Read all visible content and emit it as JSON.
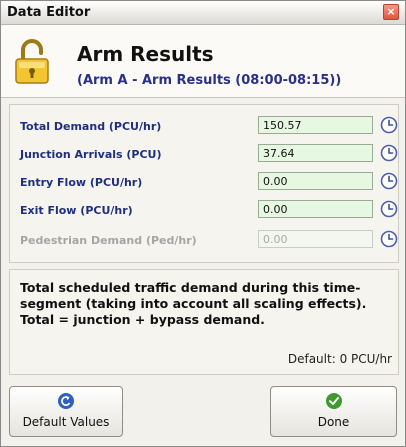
{
  "window": {
    "title": "Data Editor"
  },
  "header": {
    "title": "Arm Results",
    "subtitle": "(Arm A - Arm Results (08:00-08:15))",
    "icon": "lock-icon"
  },
  "fields": [
    {
      "label": "Total Demand (PCU/hr)",
      "value": "150.57",
      "enabled": true,
      "icon": "clock-icon"
    },
    {
      "label": "Junction Arrivals (PCU)",
      "value": "37.64",
      "enabled": true,
      "icon": "clock-icon"
    },
    {
      "label": "Entry Flow (PCU/hr)",
      "value": "0.00",
      "enabled": true,
      "icon": "clock-icon"
    },
    {
      "label": "Exit Flow (PCU/hr)",
      "value": "0.00",
      "enabled": true,
      "icon": "clock-icon"
    },
    {
      "label": "Pedestrian Demand (Ped/hr)",
      "value": "0.00",
      "enabled": false,
      "icon": "clock-icon"
    }
  ],
  "description": {
    "text": "Total scheduled traffic demand during this time-segment (taking into account all scaling effects).  Total = junction + bypass demand.",
    "default": "Default: 0 PCU/hr"
  },
  "buttons": {
    "default_values": "Default Values",
    "done": "Done"
  },
  "colors": {
    "label_blue": "#1e2f80",
    "subtitle_blue": "#2a2f88",
    "field_green": "#e7f8e2",
    "close_red": "#e0563b"
  }
}
